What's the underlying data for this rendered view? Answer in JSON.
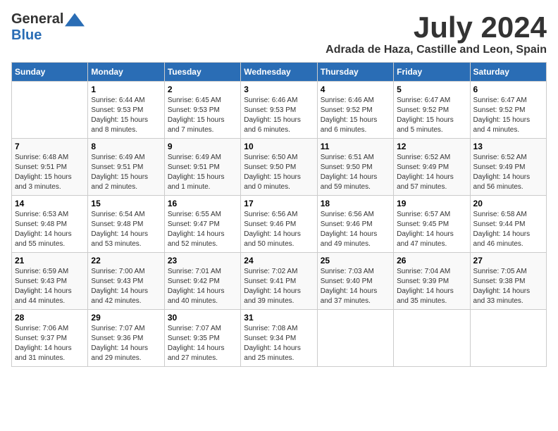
{
  "header": {
    "logo_general": "General",
    "logo_blue": "Blue",
    "month_title": "July 2024",
    "location": "Adrada de Haza, Castille and Leon, Spain"
  },
  "days_of_week": [
    "Sunday",
    "Monday",
    "Tuesday",
    "Wednesday",
    "Thursday",
    "Friday",
    "Saturday"
  ],
  "weeks": [
    [
      {
        "day": "",
        "sunrise": "",
        "sunset": "",
        "daylight": ""
      },
      {
        "day": "1",
        "sunrise": "Sunrise: 6:44 AM",
        "sunset": "Sunset: 9:53 PM",
        "daylight": "Daylight: 15 hours and 8 minutes."
      },
      {
        "day": "2",
        "sunrise": "Sunrise: 6:45 AM",
        "sunset": "Sunset: 9:53 PM",
        "daylight": "Daylight: 15 hours and 7 minutes."
      },
      {
        "day": "3",
        "sunrise": "Sunrise: 6:46 AM",
        "sunset": "Sunset: 9:53 PM",
        "daylight": "Daylight: 15 hours and 6 minutes."
      },
      {
        "day": "4",
        "sunrise": "Sunrise: 6:46 AM",
        "sunset": "Sunset: 9:52 PM",
        "daylight": "Daylight: 15 hours and 6 minutes."
      },
      {
        "day": "5",
        "sunrise": "Sunrise: 6:47 AM",
        "sunset": "Sunset: 9:52 PM",
        "daylight": "Daylight: 15 hours and 5 minutes."
      },
      {
        "day": "6",
        "sunrise": "Sunrise: 6:47 AM",
        "sunset": "Sunset: 9:52 PM",
        "daylight": "Daylight: 15 hours and 4 minutes."
      }
    ],
    [
      {
        "day": "7",
        "sunrise": "Sunrise: 6:48 AM",
        "sunset": "Sunset: 9:51 PM",
        "daylight": "Daylight: 15 hours and 3 minutes."
      },
      {
        "day": "8",
        "sunrise": "Sunrise: 6:49 AM",
        "sunset": "Sunset: 9:51 PM",
        "daylight": "Daylight: 15 hours and 2 minutes."
      },
      {
        "day": "9",
        "sunrise": "Sunrise: 6:49 AM",
        "sunset": "Sunset: 9:51 PM",
        "daylight": "Daylight: 15 hours and 1 minute."
      },
      {
        "day": "10",
        "sunrise": "Sunrise: 6:50 AM",
        "sunset": "Sunset: 9:50 PM",
        "daylight": "Daylight: 15 hours and 0 minutes."
      },
      {
        "day": "11",
        "sunrise": "Sunrise: 6:51 AM",
        "sunset": "Sunset: 9:50 PM",
        "daylight": "Daylight: 14 hours and 59 minutes."
      },
      {
        "day": "12",
        "sunrise": "Sunrise: 6:52 AM",
        "sunset": "Sunset: 9:49 PM",
        "daylight": "Daylight: 14 hours and 57 minutes."
      },
      {
        "day": "13",
        "sunrise": "Sunrise: 6:52 AM",
        "sunset": "Sunset: 9:49 PM",
        "daylight": "Daylight: 14 hours and 56 minutes."
      }
    ],
    [
      {
        "day": "14",
        "sunrise": "Sunrise: 6:53 AM",
        "sunset": "Sunset: 9:48 PM",
        "daylight": "Daylight: 14 hours and 55 minutes."
      },
      {
        "day": "15",
        "sunrise": "Sunrise: 6:54 AM",
        "sunset": "Sunset: 9:48 PM",
        "daylight": "Daylight: 14 hours and 53 minutes."
      },
      {
        "day": "16",
        "sunrise": "Sunrise: 6:55 AM",
        "sunset": "Sunset: 9:47 PM",
        "daylight": "Daylight: 14 hours and 52 minutes."
      },
      {
        "day": "17",
        "sunrise": "Sunrise: 6:56 AM",
        "sunset": "Sunset: 9:46 PM",
        "daylight": "Daylight: 14 hours and 50 minutes."
      },
      {
        "day": "18",
        "sunrise": "Sunrise: 6:56 AM",
        "sunset": "Sunset: 9:46 PM",
        "daylight": "Daylight: 14 hours and 49 minutes."
      },
      {
        "day": "19",
        "sunrise": "Sunrise: 6:57 AM",
        "sunset": "Sunset: 9:45 PM",
        "daylight": "Daylight: 14 hours and 47 minutes."
      },
      {
        "day": "20",
        "sunrise": "Sunrise: 6:58 AM",
        "sunset": "Sunset: 9:44 PM",
        "daylight": "Daylight: 14 hours and 46 minutes."
      }
    ],
    [
      {
        "day": "21",
        "sunrise": "Sunrise: 6:59 AM",
        "sunset": "Sunset: 9:43 PM",
        "daylight": "Daylight: 14 hours and 44 minutes."
      },
      {
        "day": "22",
        "sunrise": "Sunrise: 7:00 AM",
        "sunset": "Sunset: 9:43 PM",
        "daylight": "Daylight: 14 hours and 42 minutes."
      },
      {
        "day": "23",
        "sunrise": "Sunrise: 7:01 AM",
        "sunset": "Sunset: 9:42 PM",
        "daylight": "Daylight: 14 hours and 40 minutes."
      },
      {
        "day": "24",
        "sunrise": "Sunrise: 7:02 AM",
        "sunset": "Sunset: 9:41 PM",
        "daylight": "Daylight: 14 hours and 39 minutes."
      },
      {
        "day": "25",
        "sunrise": "Sunrise: 7:03 AM",
        "sunset": "Sunset: 9:40 PM",
        "daylight": "Daylight: 14 hours and 37 minutes."
      },
      {
        "day": "26",
        "sunrise": "Sunrise: 7:04 AM",
        "sunset": "Sunset: 9:39 PM",
        "daylight": "Daylight: 14 hours and 35 minutes."
      },
      {
        "day": "27",
        "sunrise": "Sunrise: 7:05 AM",
        "sunset": "Sunset: 9:38 PM",
        "daylight": "Daylight: 14 hours and 33 minutes."
      }
    ],
    [
      {
        "day": "28",
        "sunrise": "Sunrise: 7:06 AM",
        "sunset": "Sunset: 9:37 PM",
        "daylight": "Daylight: 14 hours and 31 minutes."
      },
      {
        "day": "29",
        "sunrise": "Sunrise: 7:07 AM",
        "sunset": "Sunset: 9:36 PM",
        "daylight": "Daylight: 14 hours and 29 minutes."
      },
      {
        "day": "30",
        "sunrise": "Sunrise: 7:07 AM",
        "sunset": "Sunset: 9:35 PM",
        "daylight": "Daylight: 14 hours and 27 minutes."
      },
      {
        "day": "31",
        "sunrise": "Sunrise: 7:08 AM",
        "sunset": "Sunset: 9:34 PM",
        "daylight": "Daylight: 14 hours and 25 minutes."
      },
      {
        "day": "",
        "sunrise": "",
        "sunset": "",
        "daylight": ""
      },
      {
        "day": "",
        "sunrise": "",
        "sunset": "",
        "daylight": ""
      },
      {
        "day": "",
        "sunrise": "",
        "sunset": "",
        "daylight": ""
      }
    ]
  ]
}
